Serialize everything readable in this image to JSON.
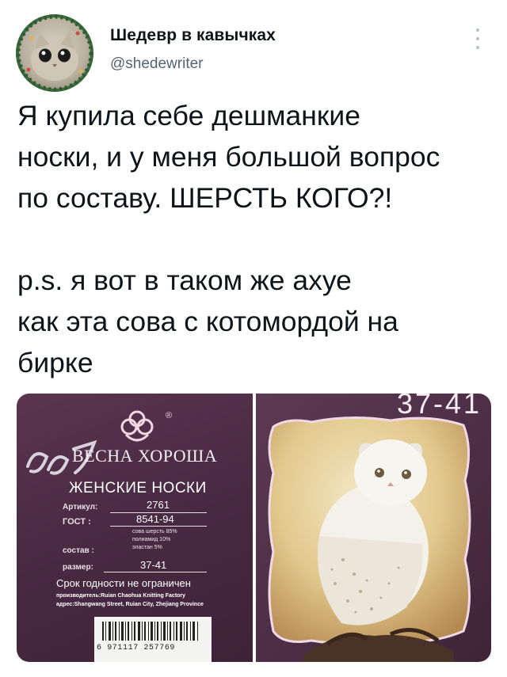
{
  "author": {
    "name": "Шедевр в кавычках",
    "handle": "@shedewriter",
    "avatar_icon": "cat-avatar-icon"
  },
  "more_icon": "more-options-icon",
  "tweet": {
    "lines_1": [
      "Я купила себе дешманкие",
      "носки, и у меня большой вопрос",
      "по составу. ШЕРСТЬ КОГО?!"
    ],
    "lines_2": [
      "p.s. я вот в таком же ахуе",
      "как эта сова с котомордой на",
      "бирке"
    ]
  },
  "tag": {
    "brand": "ВЕСНА ХОРОША",
    "title": "ЖЕНСКИЕ НОСКИ",
    "article_label": "Артикул:",
    "article_value": "2761",
    "gost_label": "ГОСТ :",
    "gost_value": "8541-94",
    "composition_label": "состав :",
    "composition_lines": [
      "сова шерсть 85%",
      "полиамид    10%",
      "эластан      5%"
    ],
    "size_label": "размер:",
    "size_value": "37-41",
    "expiry": "Срок годности не ограничен",
    "maker": "производитель:Ruian Chaohua Knitting Factory",
    "address": "адрес:Shangwang Street, Ruian City, Zhejiang Province",
    "barcode": "6 971117 257769",
    "registered_mark": "®"
  },
  "owl_photo": {
    "corner_text": "37-41"
  },
  "colors": {
    "text": "#0f1419",
    "muted": "#536471",
    "tag_bg": "#4a2a44"
  }
}
